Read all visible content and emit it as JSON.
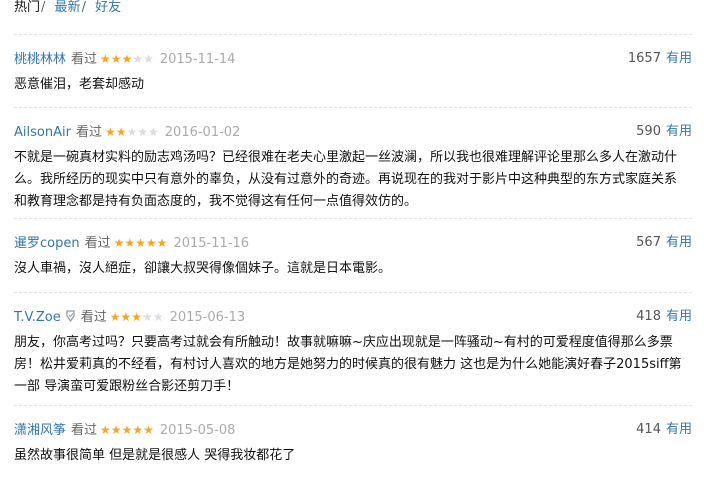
{
  "tabs": [
    {
      "label": "热门",
      "sep": "/"
    },
    {
      "label": "最新",
      "sep": "/"
    },
    {
      "label": "好友",
      "sep": ""
    }
  ],
  "reviews": [
    {
      "user": "桃桃林林",
      "seen": "看过",
      "rating": 3,
      "date": "2015-11-14",
      "count": "1657",
      "useful": "有用",
      "text": "恶意催泪，老套却感动"
    },
    {
      "user": "AilsonAir",
      "seen": "看过",
      "rating": 2,
      "date": "2016-01-02",
      "count": "590",
      "useful": "有用",
      "text": "不就是一碗真材实料的励志鸡汤吗？已经很难在老夫心里激起一丝波澜，所以我也很难理解评论里那么多人在激动什么。我所经历的现实中只有意外的辜负，从没有过意外的奇迹。再说现在的我对于影片中这种典型的东方式家庭关系和教育理念都是持有负面态度的，我不觉得这有任何一点值得效仿的。"
    },
    {
      "user": "暹罗copen",
      "seen": "看过",
      "rating": 5,
      "date": "2015-11-16",
      "count": "567",
      "useful": "有用",
      "text": "沒人車禍，沒人絕症，卻讓大叔哭得像個妹子。這就是日本電影。"
    },
    {
      "user": "T.V.Zoe",
      "seen": "看过",
      "rating": 3,
      "date": "2015-06-13",
      "count": "418",
      "useful": "有用",
      "text": "朋友，你高考过吗？只要高考过就会有所触动！故事就嘛嘛~庆应出现就是一阵骚动~有村的可爱程度值得那么多票房！松井爱莉真的不经看，有村讨人喜欢的地方是她努力的时候真的很有魅力 这也是为什么她能演好春子2015siff第一部 导演蛮可爱跟粉丝合影还剪刀手！"
    },
    {
      "user": "潇湘风筝",
      "seen": "看过",
      "rating": 5,
      "date": "2015-05-08",
      "count": "414",
      "useful": "有用",
      "text": "虽然故事很简单 但是就是很感人 哭得我妆都花了"
    }
  ],
  "colors": {
    "link": "#3377aa",
    "star_on": "#f5a623",
    "star_off": "#dcdcdc",
    "date": "#aaaaaa"
  }
}
